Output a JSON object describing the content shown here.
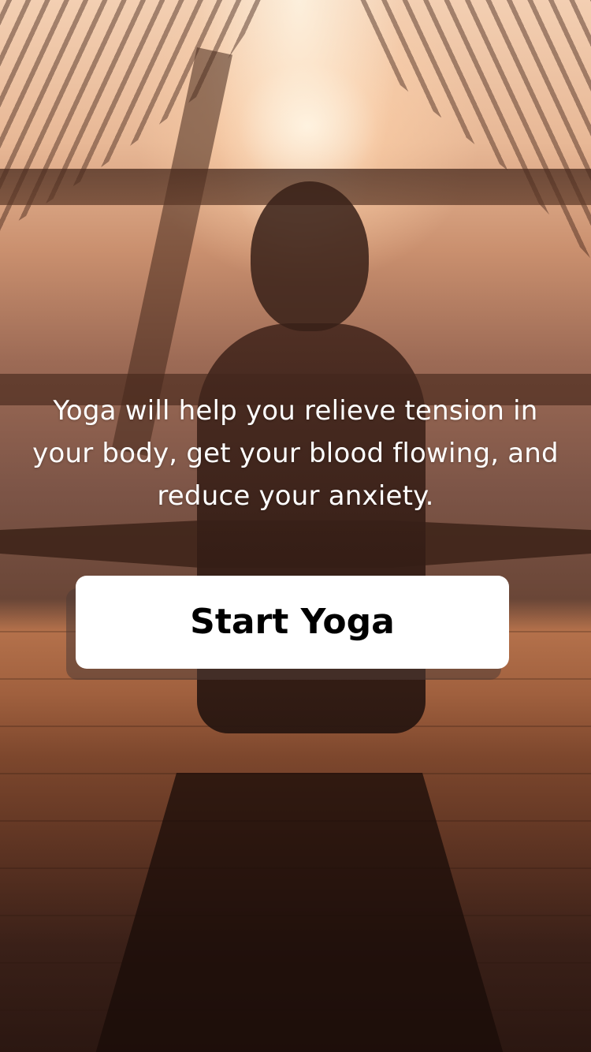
{
  "onboarding": {
    "tagline": "Yoga will help you relieve tension in your body, get your blood flowing, and reduce your anxiety.",
    "start_button_label": "Start Yoga"
  },
  "background": {
    "description_icon": "yoga-meditation-photo"
  },
  "colors": {
    "button_background": "#ffffff",
    "button_text": "#000000",
    "tagline_text": "#ffffff"
  }
}
